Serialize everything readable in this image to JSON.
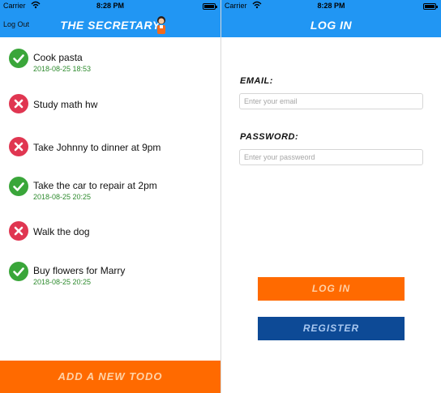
{
  "status_bar": {
    "carrier": "Carrier",
    "time": "8:28 PM"
  },
  "todo_screen": {
    "logout_label": "Log Out",
    "title": "THE SECRETARY",
    "todos": [
      {
        "title": "Cook pasta",
        "date": "2018-08-25 18:53",
        "status": "done"
      },
      {
        "title": "Study math hw",
        "date": "",
        "status": "undone"
      },
      {
        "title": "Take Johnny to dinner at 9pm",
        "date": "",
        "status": "undone"
      },
      {
        "title": "Take the car to repair at 2pm",
        "date": "2018-08-25 20:25",
        "status": "done"
      },
      {
        "title": "Walk the dog",
        "date": "",
        "status": "undone"
      },
      {
        "title": "Buy flowers for Marry",
        "date": "2018-08-25 20:25",
        "status": "done"
      }
    ],
    "add_button_label": "ADD A NEW TODO"
  },
  "login_screen": {
    "title": "LOG IN",
    "email_label": "EMAIL:",
    "email_placeholder": "Enter your email",
    "password_label": "PASSWORD:",
    "password_placeholder": "Enter your passweord",
    "login_button_label": "LOG IN",
    "register_button_label": "REGISTER"
  },
  "colors": {
    "nav_blue": "#2196f3",
    "accent_orange": "#ff6a00",
    "register_blue": "#0d4a96",
    "done_green": "#3aa63a",
    "undone_red": "#e03651",
    "date_green": "#2e8b2e"
  },
  "icons": {
    "done": "check-circle-icon",
    "undone": "x-circle-icon",
    "wifi": "wifi-icon",
    "battery": "battery-icon",
    "mascot": "secretary-mascot-icon"
  }
}
